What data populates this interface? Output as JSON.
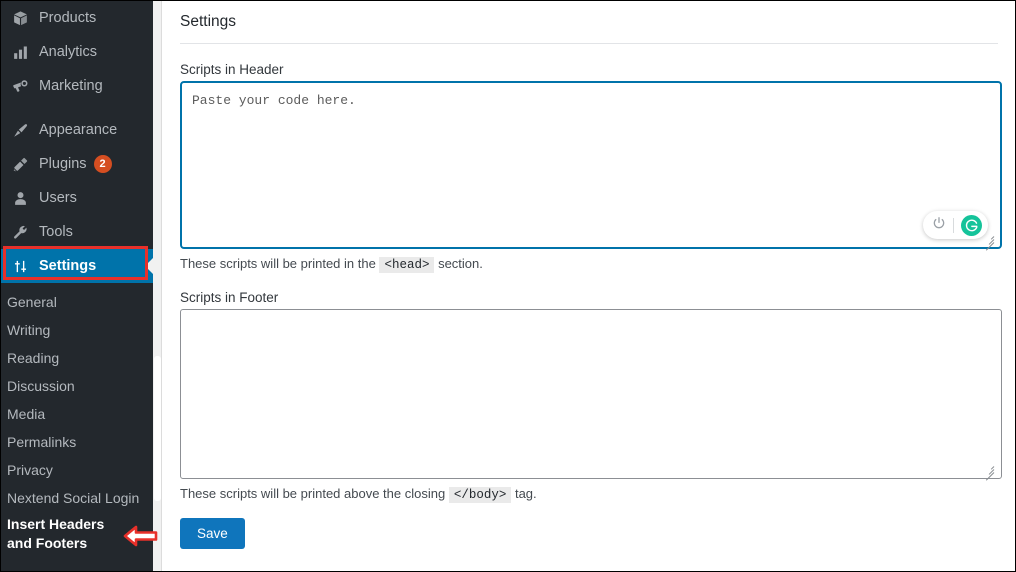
{
  "sidebar": {
    "menu_items": [
      {
        "label": "Products",
        "icon": "box-icon",
        "badge": null,
        "current": false,
        "separator_after": false
      },
      {
        "label": "Analytics",
        "icon": "bar-chart-icon",
        "badge": null,
        "current": false,
        "separator_after": false
      },
      {
        "label": "Marketing",
        "icon": "megaphone-icon",
        "badge": null,
        "current": false,
        "separator_after": true
      },
      {
        "label": "Appearance",
        "icon": "brush-icon",
        "badge": null,
        "current": false,
        "separator_after": false
      },
      {
        "label": "Plugins",
        "icon": "plug-icon",
        "badge": "2",
        "current": false,
        "separator_after": false
      },
      {
        "label": "Users",
        "icon": "user-icon",
        "badge": null,
        "current": false,
        "separator_after": false
      },
      {
        "label": "Tools",
        "icon": "wrench-icon",
        "badge": null,
        "current": false,
        "separator_after": false
      },
      {
        "label": "Settings",
        "icon": "sliders-icon",
        "badge": null,
        "current": true,
        "separator_after": false
      }
    ],
    "submenu_items": [
      {
        "label": "General",
        "current": false
      },
      {
        "label": "Writing",
        "current": false
      },
      {
        "label": "Reading",
        "current": false
      },
      {
        "label": "Discussion",
        "current": false
      },
      {
        "label": "Media",
        "current": false
      },
      {
        "label": "Permalinks",
        "current": false
      },
      {
        "label": "Privacy",
        "current": false
      },
      {
        "label": "Nextend Social Login",
        "current": false
      },
      {
        "label": "Insert Headers and Footers",
        "current": true
      }
    ]
  },
  "content": {
    "page_title": "Settings",
    "header_field": {
      "label": "Scripts in Header",
      "value": "",
      "placeholder": "Paste your code here.",
      "focused": true,
      "help_before": "These scripts will be printed in the",
      "help_tag": "<head>",
      "help_after": "section."
    },
    "footer_field": {
      "label": "Scripts in Footer",
      "value": "",
      "placeholder": "",
      "focused": false,
      "help_before": "These scripts will be printed above the closing",
      "help_tag": "</body>",
      "help_after": "tag."
    },
    "save_label": "Save",
    "grammarly": {
      "power_icon": "power-icon",
      "logo_icon": "grammarly-g-icon"
    }
  },
  "annotations": {
    "settings_highlight": "red-rectangle-highlight",
    "footers_pointer": "red-left-arrow"
  },
  "colors": {
    "sidebar_bg": "#23282d",
    "current_menu_bg": "#0073aa",
    "badge_bg": "#d54e21",
    "focus_border": "#0073aa",
    "save_button_bg": "#0f75bc",
    "annotation_red": "#e8302a",
    "grammarly_green": "#15c39a"
  }
}
